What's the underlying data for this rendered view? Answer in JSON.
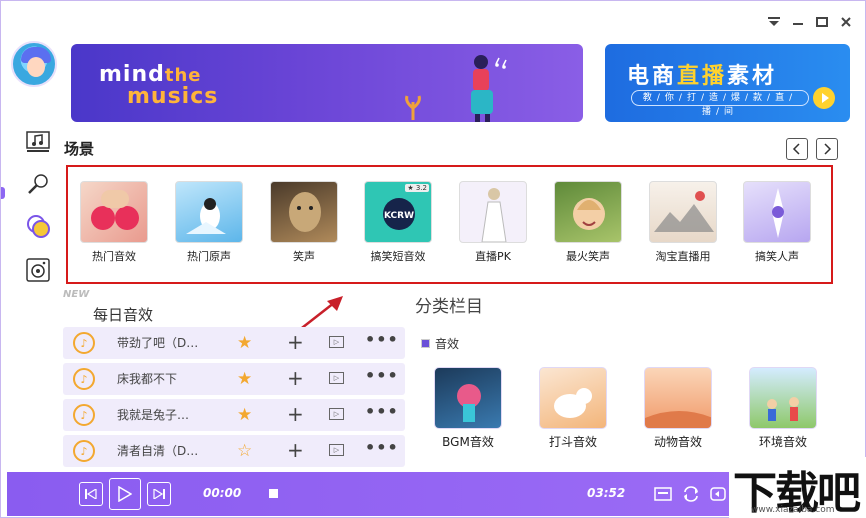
{
  "window": {
    "controls": [
      "menu-icon",
      "minimize-icon",
      "maximize-icon",
      "close-icon"
    ]
  },
  "banners": {
    "main_line1": "mind",
    "main_line1_accent": "the",
    "main_line2": "musics",
    "side_title_part1": "电商",
    "side_title_accent": "直播",
    "side_title_part2": "素材",
    "side_subtitle": "教/你/打/造/爆/款/直/播/间"
  },
  "scenes": {
    "title": "场景",
    "items": [
      {
        "label": "热门音效"
      },
      {
        "label": "热门原声"
      },
      {
        "label": "笑声"
      },
      {
        "label": "搞笑短音效",
        "badge": "3.2"
      },
      {
        "label": "直播PK"
      },
      {
        "label": "最火笑声"
      },
      {
        "label": "淘宝直播用"
      },
      {
        "label": "搞笑人声"
      }
    ]
  },
  "daily": {
    "new_tag": "NEW",
    "title": "每日音效",
    "tracks": [
      {
        "name": "带劲了吧（D…",
        "starred": true
      },
      {
        "name": "床我都不下",
        "starred": true
      },
      {
        "name": "我就是兔子…",
        "starred": true
      },
      {
        "name": "清者自清（D…",
        "starred": false
      }
    ]
  },
  "categories": {
    "title": "分类栏目",
    "subtitle": "音效",
    "items": [
      {
        "label": "BGM音效"
      },
      {
        "label": "打斗音效"
      },
      {
        "label": "动物音效"
      },
      {
        "label": "环境音效"
      }
    ]
  },
  "player": {
    "current_time": "00:00",
    "total_time": "03:52"
  },
  "watermark": {
    "big": "下载吧",
    "small": "www.xiazaiba.com"
  },
  "colors": {
    "accent": "#8a5cf0",
    "highlight_box": "#d61a1a",
    "star": "#f3a830"
  }
}
